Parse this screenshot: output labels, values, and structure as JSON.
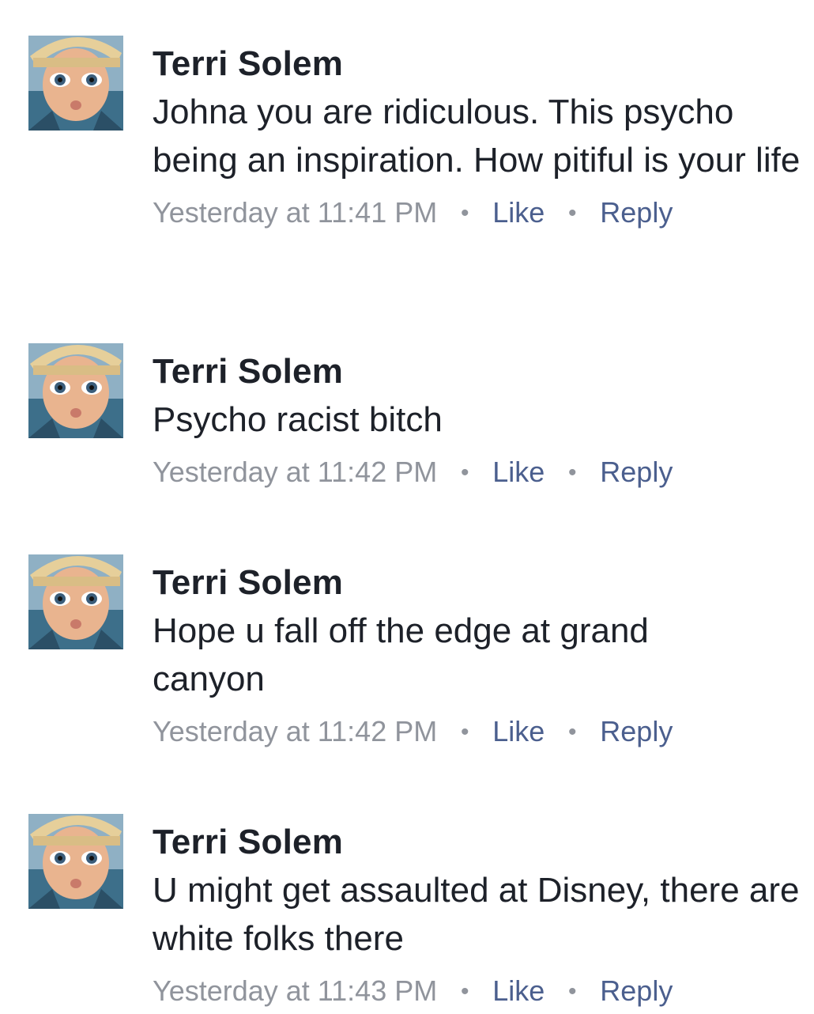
{
  "comments": [
    {
      "author": "Terri Solem",
      "text": "Johna you are ridiculous. This psycho being an inspiration. How pitiful is your life",
      "timestamp": "Yesterday at 11:41 PM",
      "like_label": "Like",
      "reply_label": "Reply"
    },
    {
      "author": "Terri Solem",
      "text": "Psycho racist bitch",
      "timestamp": "Yesterday at 11:42 PM",
      "like_label": "Like",
      "reply_label": "Reply"
    },
    {
      "author": "Terri Solem",
      "text": "Hope u fall off the edge at grand canyon",
      "timestamp": "Yesterday at 11:42 PM",
      "like_label": "Like",
      "reply_label": "Reply"
    },
    {
      "author": "Terri Solem",
      "text": "U might get assaulted at Disney, there are white folks there",
      "timestamp": "Yesterday at 11:43 PM",
      "like_label": "Like",
      "reply_label": "Reply"
    }
  ],
  "separator": "•",
  "colors": {
    "author_text": "#1d2129",
    "timestamp": "#90949c",
    "action_link": "#4b5f8e",
    "background": "#ffffff"
  }
}
